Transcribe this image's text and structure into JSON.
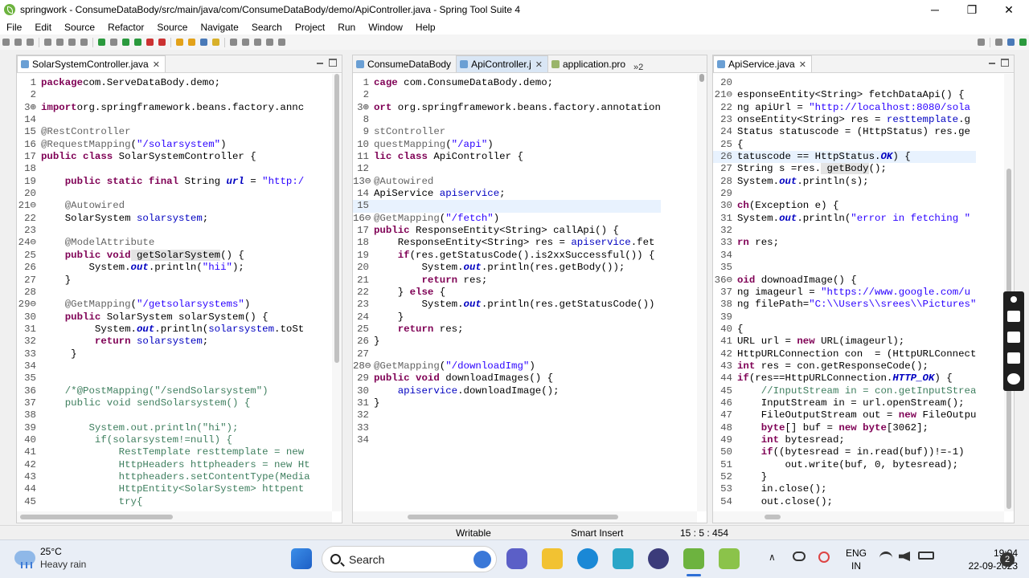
{
  "window": {
    "title": "springwork - ConsumeDataBody/src/main/java/com/ConsumeDataBody/demo/ApiController.java - Spring Tool Suite 4",
    "minimize": "─",
    "restore": "❐",
    "close": "✕"
  },
  "menu": [
    "File",
    "Edit",
    "Source",
    "Refactor",
    "Source",
    "Navigate",
    "Search",
    "Project",
    "Run",
    "Window",
    "Help"
  ],
  "left_pane": {
    "tab": "SolarSystemController.java",
    "close": "✕",
    "lines": [
      [
        "1",
        [
          [
            "kw",
            "package"
          ],
          [
            "",
            "com.ServeDataBody.demo;"
          ]
        ]
      ],
      [
        "2",
        []
      ],
      [
        "3⊕",
        [
          [
            "kw",
            "import"
          ],
          [
            "",
            "org.springframework.beans.factory.annc"
          ]
        ]
      ],
      [
        "14",
        []
      ],
      [
        "15",
        [
          [
            "an",
            "@RestController"
          ]
        ]
      ],
      [
        "16",
        [
          [
            "an",
            "@RequestMapping"
          ],
          [
            "",
            "("
          ],
          [
            "st",
            "\"/solarsystem\""
          ],
          [
            "",
            ")"
          ]
        ]
      ],
      [
        "17",
        [
          [
            "kw",
            "public class"
          ],
          [
            "",
            " SolarSystemController {"
          ]
        ]
      ],
      [
        "18",
        []
      ],
      [
        "19",
        [
          [
            "",
            "    "
          ],
          [
            "kw",
            "public static final"
          ],
          [
            "",
            " String "
          ],
          [
            "sf",
            "url"
          ],
          [
            "",
            " = "
          ],
          [
            "st",
            "\"http:/"
          ]
        ]
      ],
      [
        "20",
        []
      ],
      [
        "21⊖",
        [
          [
            "",
            "    "
          ],
          [
            "an",
            "@Autowired"
          ]
        ]
      ],
      [
        "22",
        [
          [
            "",
            "    SolarSystem "
          ],
          [
            "fd",
            "solarsystem"
          ],
          [
            "",
            ";"
          ]
        ]
      ],
      [
        "23",
        []
      ],
      [
        "24⊖",
        [
          [
            "",
            "    "
          ],
          [
            "an",
            "@ModelAttribute"
          ]
        ]
      ],
      [
        "25",
        [
          [
            "",
            "    "
          ],
          [
            "kw",
            "public void"
          ],
          [
            " hl",
            "getSolarSystem"
          ],
          [
            "",
            "() {"
          ]
        ]
      ],
      [
        "26",
        [
          [
            "",
            "        System."
          ],
          [
            "sf",
            "out"
          ],
          [
            "",
            ".println("
          ],
          [
            "st",
            "\"hii\""
          ],
          [
            "",
            ");"
          ]
        ]
      ],
      [
        "27",
        [
          [
            "",
            "    }"
          ]
        ]
      ],
      [
        "28",
        []
      ],
      [
        "29⊖",
        [
          [
            "",
            "    "
          ],
          [
            "an",
            "@GetMapping"
          ],
          [
            "",
            "("
          ],
          [
            "st",
            "\"/getsolarsystems\""
          ],
          [
            "",
            ")"
          ]
        ]
      ],
      [
        "30",
        [
          [
            "",
            "    "
          ],
          [
            "kw",
            "public"
          ],
          [
            "",
            " SolarSystem solarSystem() {"
          ]
        ]
      ],
      [
        "31",
        [
          [
            "",
            "         System."
          ],
          [
            "sf",
            "out"
          ],
          [
            "",
            ".println("
          ],
          [
            "fd",
            "solarsystem"
          ],
          [
            "",
            ".toSt"
          ]
        ]
      ],
      [
        "32",
        [
          [
            "",
            "         "
          ],
          [
            "kw",
            "return"
          ],
          [
            " fd",
            "solarsystem"
          ],
          [
            "",
            ";"
          ]
        ]
      ],
      [
        "33",
        [
          [
            "",
            "     }"
          ]
        ]
      ],
      [
        "34",
        []
      ],
      [
        "35",
        []
      ],
      [
        "36",
        [
          [
            "",
            "    "
          ],
          [
            "cm",
            "/*@PostMapping(\"/sendSolarsystem\")"
          ]
        ]
      ],
      [
        "37",
        [
          [
            "",
            "    "
          ],
          [
            "cm",
            "public void sendSolarsystem() {"
          ]
        ]
      ],
      [
        "38",
        []
      ],
      [
        "39",
        [
          [
            "",
            "        "
          ],
          [
            "cm",
            "System.out.println(\"hi\");"
          ]
        ]
      ],
      [
        "40",
        [
          [
            "",
            "         "
          ],
          [
            "cm",
            "if(solarsystem!=null) {"
          ]
        ]
      ],
      [
        "41",
        [
          [
            "",
            "             "
          ],
          [
            "cm",
            "RestTemplate resttemplate = new"
          ]
        ]
      ],
      [
        "42",
        [
          [
            "",
            "             "
          ],
          [
            "cm",
            "HttpHeaders httpheaders = new Ht"
          ]
        ]
      ],
      [
        "43",
        [
          [
            "",
            "             "
          ],
          [
            "cm",
            "httpheaders.setContentType(Media"
          ]
        ]
      ],
      [
        "44",
        [
          [
            "",
            "             "
          ],
          [
            "cm",
            "HttpEntity<SolarSystem> httpent"
          ]
        ]
      ],
      [
        "45",
        [
          [
            "",
            "             "
          ],
          [
            "cm",
            "try{"
          ]
        ]
      ]
    ]
  },
  "middle_pane": {
    "tabs": [
      "ConsumeDataBody",
      "ApiController.j",
      "application.pro"
    ],
    "overflow": "»2",
    "close": "✕",
    "lines": [
      [
        "1",
        [
          [
            "kw",
            "cage"
          ],
          [
            "",
            " com.ConsumeDataBody.demo;"
          ]
        ]
      ],
      [
        "2",
        []
      ],
      [
        "3⊕",
        [
          [
            "kw",
            "ort"
          ],
          [
            "",
            " org.springframework.beans.factory.annotation"
          ]
        ]
      ],
      [
        "8",
        []
      ],
      [
        "9",
        [
          [
            "an",
            "stController"
          ]
        ]
      ],
      [
        "10",
        [
          [
            "an",
            "questMapping"
          ],
          [
            "",
            "("
          ],
          [
            "st",
            "\"/api\""
          ],
          [
            "",
            ")"
          ]
        ]
      ],
      [
        "11",
        [
          [
            "kw",
            "lic class"
          ],
          [
            "",
            " ApiController {"
          ]
        ]
      ],
      [
        "12",
        []
      ],
      [
        "13⊖",
        [
          [
            "an",
            "@Autowired"
          ]
        ]
      ],
      [
        "14",
        [
          [
            "",
            "ApiService "
          ],
          [
            "fd",
            "apiservice"
          ],
          [
            "",
            ";"
          ]
        ]
      ],
      [
        "15",
        []
      ],
      [
        "16⊖",
        [
          [
            "an",
            "@GetMapping"
          ],
          [
            "",
            "("
          ],
          [
            "st",
            "\"/fetch\""
          ],
          [
            "",
            ")"
          ]
        ]
      ],
      [
        "17",
        [
          [
            "kw",
            "public"
          ],
          [
            "",
            " ResponseEntity<String> callApi() {"
          ]
        ]
      ],
      [
        "18",
        [
          [
            "",
            "    ResponseEntity<String> res = "
          ],
          [
            "fd",
            "apiservice"
          ],
          [
            "",
            ".fet"
          ]
        ]
      ],
      [
        "19",
        [
          [
            "",
            "    "
          ],
          [
            "kw",
            "if"
          ],
          [
            "",
            "(res.getStatusCode().is2xxSuccessful()) {"
          ]
        ]
      ],
      [
        "20",
        [
          [
            "",
            "        System."
          ],
          [
            "sf",
            "out"
          ],
          [
            "",
            ".println(res.getBody());"
          ]
        ]
      ],
      [
        "21",
        [
          [
            "",
            "        "
          ],
          [
            "kw",
            "return"
          ],
          [
            "",
            " res;"
          ]
        ]
      ],
      [
        "22",
        [
          [
            "",
            "    } "
          ],
          [
            "kw",
            "else"
          ],
          [
            "",
            " {"
          ]
        ]
      ],
      [
        "23",
        [
          [
            "",
            "        System."
          ],
          [
            "sf",
            "out"
          ],
          [
            "",
            ".println(res.getStatusCode())"
          ]
        ]
      ],
      [
        "24",
        [
          [
            "",
            "    }"
          ]
        ]
      ],
      [
        "25",
        [
          [
            "",
            "    "
          ],
          [
            "kw",
            "return"
          ],
          [
            "",
            " res;"
          ]
        ]
      ],
      [
        "26",
        [
          [
            "",
            "}"
          ]
        ]
      ],
      [
        "27",
        []
      ],
      [
        "28⊖",
        [
          [
            "an",
            "@GetMapping"
          ],
          [
            "",
            "("
          ],
          [
            "st",
            "\"/downloadImg\""
          ],
          [
            "",
            ")"
          ]
        ]
      ],
      [
        "29",
        [
          [
            "kw",
            "public void"
          ],
          [
            "",
            " downloadImages() {"
          ]
        ]
      ],
      [
        "30",
        [
          [
            "",
            "    "
          ],
          [
            "fd",
            "apiservice"
          ],
          [
            "",
            ".downloadImage();"
          ]
        ]
      ],
      [
        "31",
        [
          [
            "",
            "}"
          ]
        ]
      ],
      [
        "32",
        []
      ],
      [
        "33",
        []
      ],
      [
        "34",
        []
      ]
    ]
  },
  "right_pane": {
    "tab": "ApiService.java",
    "close": "✕",
    "lines": [
      [
        "20",
        []
      ],
      [
        "21⊖",
        [
          [
            "",
            "esponseEntity<String> fetchDataApi() {"
          ]
        ]
      ],
      [
        "22",
        [
          [
            "",
            "ng apiUrl = "
          ],
          [
            "st",
            "\"http://localhost:8080/sola"
          ]
        ]
      ],
      [
        "23",
        [
          [
            "",
            "onseEntity<String> res = "
          ],
          [
            "fd",
            "resttemplate"
          ],
          [
            "",
            ".g"
          ]
        ]
      ],
      [
        "24",
        [
          [
            "",
            "Status statuscode = (HttpStatus) res.ge"
          ]
        ]
      ],
      [
        "25",
        [
          [
            "",
            "{"
          ]
        ]
      ],
      [
        "26",
        [
          [
            "",
            "tatuscode == HttpStatus."
          ],
          [
            "sf",
            "OK"
          ],
          [
            "",
            ") {"
          ]
        ]
      ],
      [
        "27",
        [
          [
            "",
            "String s =res."
          ],
          [
            " hl",
            "getBody"
          ],
          [
            "",
            "();"
          ]
        ]
      ],
      [
        "28",
        [
          [
            "",
            "System."
          ],
          [
            "sf",
            "out"
          ],
          [
            "",
            ".println(s);"
          ]
        ]
      ],
      [
        "29",
        []
      ],
      [
        "30",
        [
          [
            "kw",
            "ch"
          ],
          [
            "",
            "(Exception e) {"
          ]
        ]
      ],
      [
        "31",
        [
          [
            "",
            "System."
          ],
          [
            "sf",
            "out"
          ],
          [
            "",
            ".println("
          ],
          [
            "st",
            "\"error in fetching \""
          ]
        ]
      ],
      [
        "32",
        []
      ],
      [
        "33",
        [
          [
            "kw",
            "rn"
          ],
          [
            "",
            " res;"
          ]
        ]
      ],
      [
        "34",
        []
      ],
      [
        "35",
        []
      ],
      [
        "36⊖",
        [
          [
            "kw",
            "oid"
          ],
          [
            "",
            " downoadImage() {"
          ]
        ]
      ],
      [
        "37",
        [
          [
            "",
            "ng imageurl = "
          ],
          [
            "st",
            "\"https://www.google.com/u"
          ]
        ]
      ],
      [
        "38",
        [
          [
            "",
            "ng filePath="
          ],
          [
            "st",
            "\"C:\\\\Users\\\\srees\\\\Pictures\""
          ]
        ]
      ],
      [
        "39",
        []
      ],
      [
        "40",
        [
          [
            "",
            "{"
          ]
        ]
      ],
      [
        "41",
        [
          [
            "",
            "URL url = "
          ],
          [
            "kw",
            "new"
          ],
          [
            "",
            " URL(imageurl);"
          ]
        ]
      ],
      [
        "42",
        [
          [
            "",
            "HttpURLConnection con  = (HttpURLConnect"
          ]
        ]
      ],
      [
        "43",
        [
          [
            "kw",
            "int"
          ],
          [
            "",
            " res = con.getResponseCode();"
          ]
        ]
      ],
      [
        "44",
        [
          [
            "kw",
            "if"
          ],
          [
            "",
            "(res==HttpURLConnection."
          ],
          [
            "sf",
            "HTTP_OK"
          ],
          [
            "",
            ") {"
          ]
        ]
      ],
      [
        "45",
        [
          [
            "",
            "    "
          ],
          [
            "cm",
            "//InputStream in = con.getInputStrea"
          ]
        ]
      ],
      [
        "46",
        [
          [
            "",
            "    InputStream in = url.openStream();"
          ]
        ]
      ],
      [
        "47",
        [
          [
            "",
            "    FileOutputStream out = "
          ],
          [
            "kw",
            "new"
          ],
          [
            "",
            " FileOutpu"
          ]
        ]
      ],
      [
        "48",
        [
          [
            "",
            "    "
          ],
          [
            "kw",
            "byte"
          ],
          [
            "",
            "[] buf = "
          ],
          [
            "kw",
            "new byte"
          ],
          [
            "",
            "[3062];"
          ]
        ]
      ],
      [
        "49",
        [
          [
            "",
            "    "
          ],
          [
            "kw",
            "int"
          ],
          [
            "",
            " bytesread;"
          ]
        ]
      ],
      [
        "50",
        [
          [
            "",
            "    "
          ],
          [
            "kw",
            "if"
          ],
          [
            "",
            "((bytesread = in.read(buf))!=-1)"
          ]
        ]
      ],
      [
        "51",
        [
          [
            "",
            "        out.write(buf, 0, bytesread);"
          ]
        ]
      ],
      [
        "52",
        [
          [
            "",
            "    }"
          ]
        ]
      ],
      [
        "53",
        [
          [
            "",
            "    in.close();"
          ]
        ]
      ],
      [
        "54",
        [
          [
            "",
            "    out.close();"
          ]
        ]
      ]
    ]
  },
  "status": {
    "writable": "Writable",
    "insert_mode": "Smart Insert",
    "position": "15 : 5 : 454"
  },
  "taskbar": {
    "temperature": "25°C",
    "weather": "Heavy rain",
    "search": "Search",
    "language_1": "ENG",
    "language_2": "IN",
    "time": "19:04",
    "date": "22-09-2023",
    "notification_count": "2",
    "tray_chevron": "∧"
  }
}
